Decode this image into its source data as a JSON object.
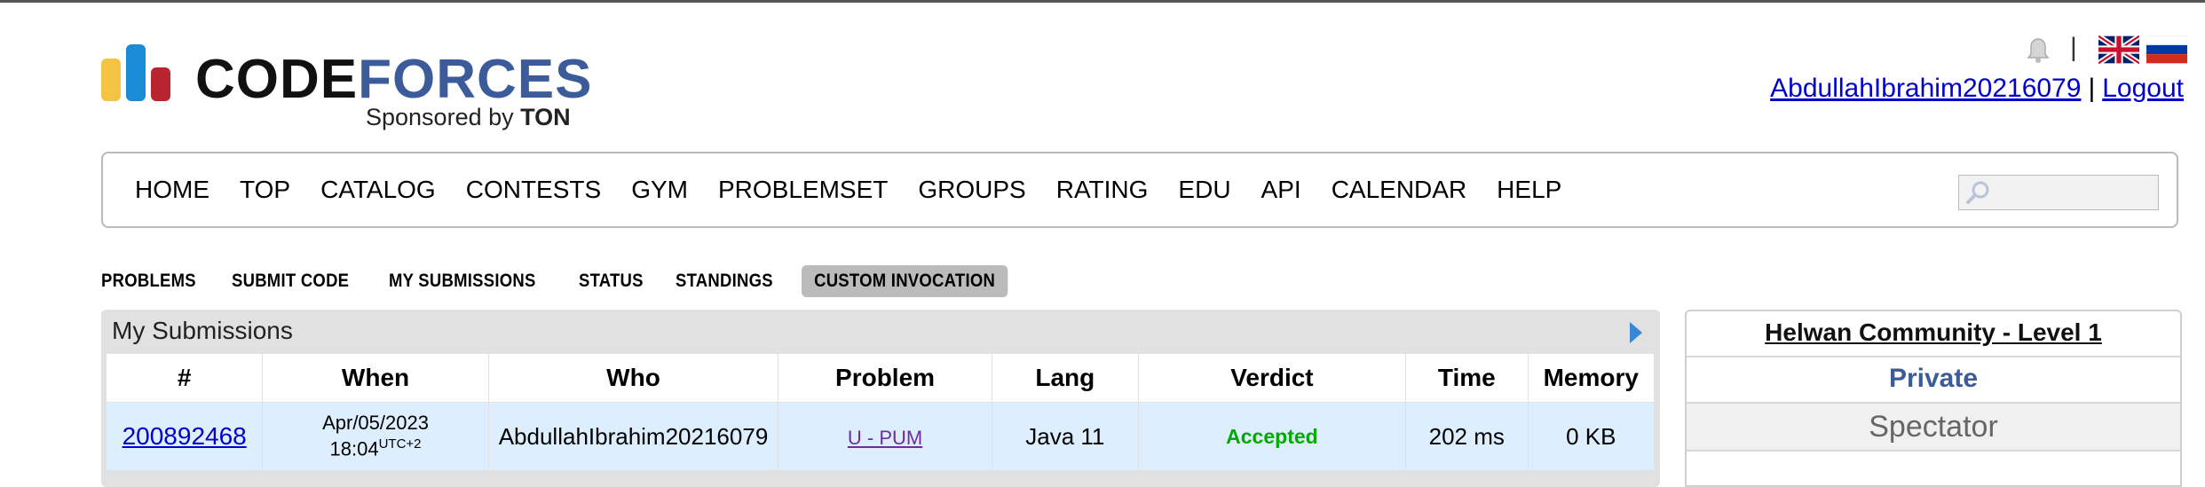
{
  "header": {
    "logo_code": "CODE",
    "logo_forces": "FORCES",
    "sponsor_prefix": "Sponsored by ",
    "sponsor_name": "TON",
    "separator": "|",
    "username": "AbdullahIbrahim20216079",
    "user_separator": "|",
    "logout_label": "Logout",
    "icons": [
      "bell-icon",
      "uk-flag-icon",
      "russia-flag-icon"
    ]
  },
  "menu": {
    "items": [
      "HOME",
      "TOP",
      "CATALOG",
      "CONTESTS",
      "GYM",
      "PROBLEMSET",
      "GROUPS",
      "RATING",
      "EDU",
      "API",
      "CALENDAR",
      "HELP"
    ],
    "search_placeholder": ""
  },
  "submenu": {
    "items": [
      "PROBLEMS",
      "SUBMIT CODE",
      "MY SUBMISSIONS",
      "STATUS",
      "STANDINGS",
      "CUSTOM INVOCATION"
    ],
    "active": "CUSTOM INVOCATION"
  },
  "submissions": {
    "caption": "My Submissions",
    "columns": [
      "#",
      "When",
      "Who",
      "Problem",
      "Lang",
      "Verdict",
      "Time",
      "Memory"
    ],
    "rows": [
      {
        "id": "200892468",
        "date": "Apr/05/2023",
        "time": "18:04",
        "tz": "UTC+2",
        "who": "AbdullahIbrahim20216079",
        "problem": "U - PUM",
        "lang": "Java 11",
        "verdict": "Accepted",
        "exec_time": "202 ms",
        "memory": "0 KB"
      }
    ]
  },
  "sidebar": {
    "title": "Helwan Community - Level 1",
    "visibility": "Private",
    "role": "Spectator"
  },
  "colors": {
    "brand_blue": "#3b5b9b",
    "logo_yellow": "#f5c342",
    "logo_blue": "#1a8bd6",
    "logo_red": "#b8252e",
    "accepted_green": "#00aa00",
    "row_highlight": "#ddeeff"
  }
}
